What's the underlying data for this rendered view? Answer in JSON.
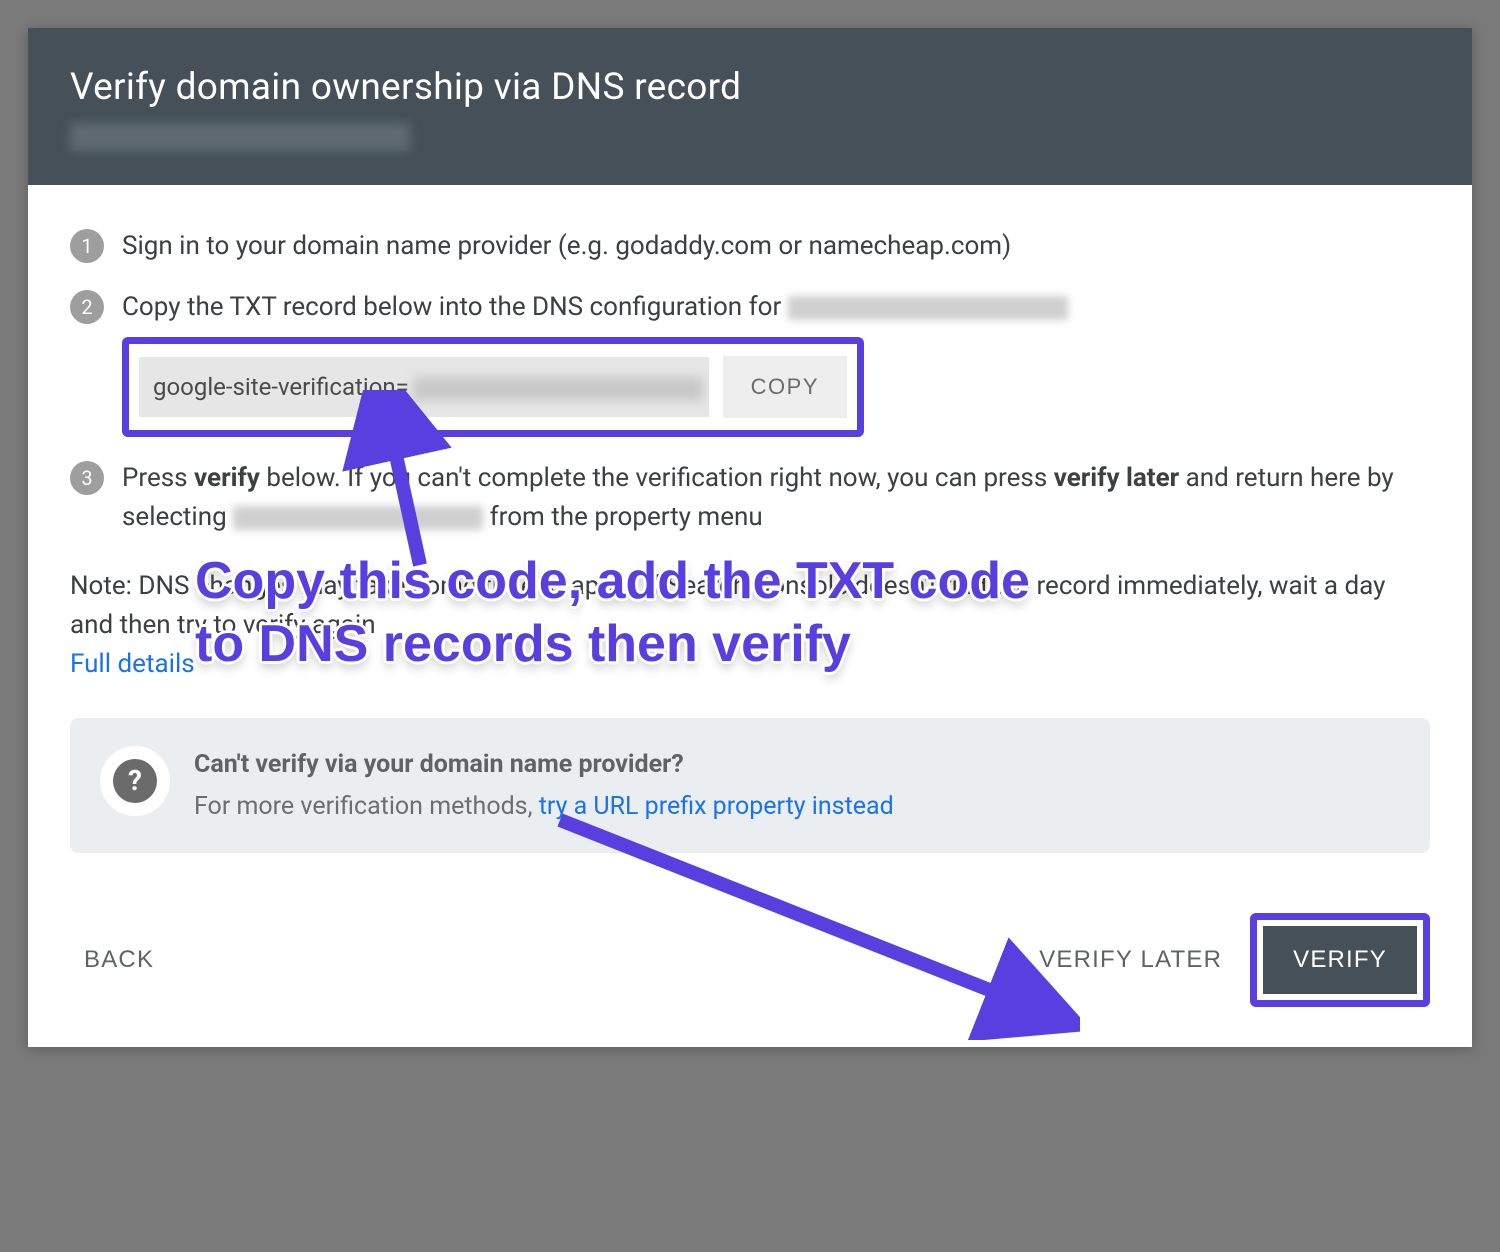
{
  "header": {
    "title": "Verify domain ownership via DNS record"
  },
  "steps": {
    "s1": {
      "num": "1",
      "text": "Sign in to your domain name provider (e.g. godaddy.com or namecheap.com)"
    },
    "s2": {
      "num": "2",
      "lead": "Copy the TXT record below into the DNS configuration for ",
      "txt_prefix": "google-site-verification=",
      "copy_label": "COPY"
    },
    "s3": {
      "num": "3",
      "p1a": "Press ",
      "p1b": "verify",
      "p1c": " below. If you can't complete the verification right now, you can press ",
      "p1d": "verify later",
      "p1e": " and return here by selecting ",
      "p1f": " from the property menu"
    }
  },
  "note": {
    "line1a": "Note: DNS changes may take some time to apply. If Search Console doesn't find the record immediately, wait a day and then try to verify again",
    "link": "Full details"
  },
  "tip": {
    "title": "Can't verify via your domain name provider?",
    "sub_a": "For more verification methods, ",
    "sub_link": "try a URL prefix property instead"
  },
  "footer": {
    "back": "BACK",
    "verify_later": "VERIFY LATER",
    "verify": "VERIFY"
  },
  "annotation": {
    "text": "Copy this code, add the TXT code to DNS records then verify"
  },
  "colors": {
    "accent": "#5a3fe0",
    "header_bg": "#455059",
    "link": "#1a73e8"
  }
}
